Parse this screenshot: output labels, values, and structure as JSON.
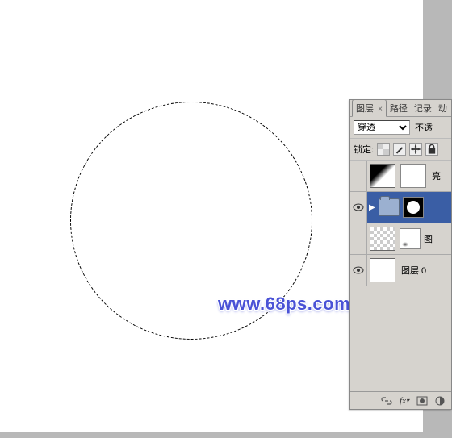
{
  "watermark": "www.68ps.com",
  "panel": {
    "tabs": {
      "layers": "图层",
      "paths": "路径",
      "history": "记录",
      "actions": "动"
    },
    "blend_mode": "穿透",
    "opacity_label": "不透",
    "lock_label": "锁定:"
  },
  "layers": [
    {
      "name": "亮",
      "visible": false
    },
    {
      "name": "",
      "visible": true
    },
    {
      "name": "图",
      "visible": false
    },
    {
      "name": "图层 0",
      "visible": true
    }
  ],
  "bottom_icons": {
    "link": "link-icon",
    "fx": "fx",
    "mask": "mask-icon",
    "adjustment": "adjustment-icon"
  }
}
